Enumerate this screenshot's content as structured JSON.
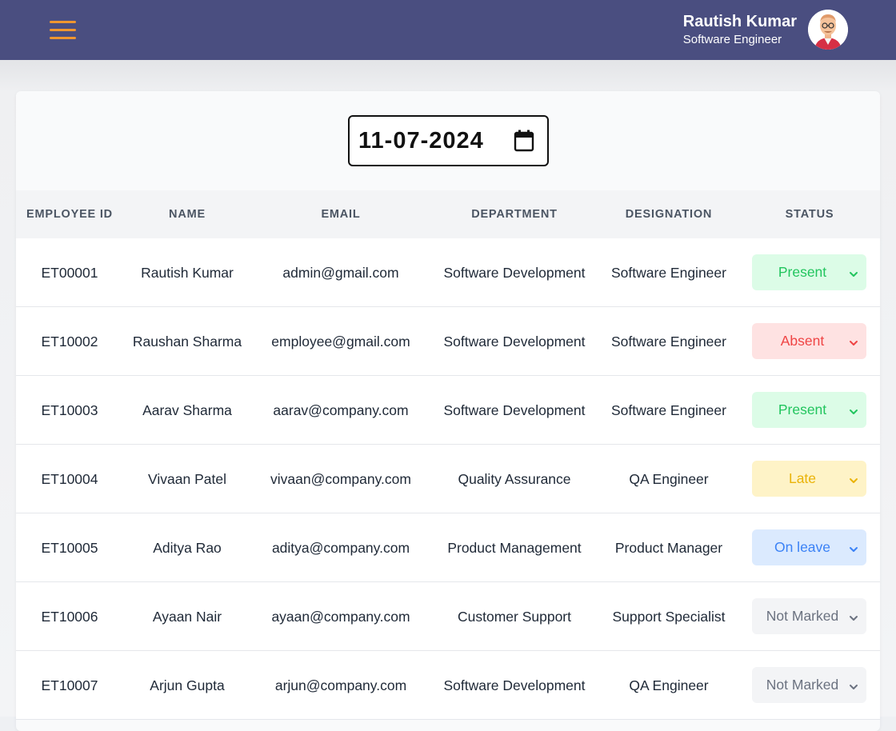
{
  "header": {
    "user_name": "Rautish Kumar",
    "user_role": "Software Engineer",
    "accent_color": "#f0962f",
    "bar_color": "#4a4e80"
  },
  "date_picker": {
    "value": "11-07-2024"
  },
  "table": {
    "columns": [
      "EMPLOYEE ID",
      "NAME",
      "EMAIL",
      "DEPARTMENT",
      "DESIGNATION",
      "STATUS"
    ],
    "rows": [
      {
        "id": "ET00001",
        "name": "Rautish Kumar",
        "email": "admin@gmail.com",
        "department": "Software Development",
        "designation": "Software Engineer",
        "status": "Present"
      },
      {
        "id": "ET10002",
        "name": "Raushan Sharma",
        "email": "employee@gmail.com",
        "department": "Software Development",
        "designation": "Software Engineer",
        "status": "Absent"
      },
      {
        "id": "ET10003",
        "name": "Aarav Sharma",
        "email": "aarav@company.com",
        "department": "Software Development",
        "designation": "Software Engineer",
        "status": "Present"
      },
      {
        "id": "ET10004",
        "name": "Vivaan Patel",
        "email": "vivaan@company.com",
        "department": "Quality Assurance",
        "designation": "QA Engineer",
        "status": "Late"
      },
      {
        "id": "ET10005",
        "name": "Aditya Rao",
        "email": "aditya@company.com",
        "department": "Product Management",
        "designation": "Product Manager",
        "status": "On leave"
      },
      {
        "id": "ET10006",
        "name": "Ayaan Nair",
        "email": "ayaan@company.com",
        "department": "Customer Support",
        "designation": "Support Specialist",
        "status": "Not Marked"
      },
      {
        "id": "ET10007",
        "name": "Arjun Gupta",
        "email": "arjun@company.com",
        "department": "Software Development",
        "designation": "QA Engineer",
        "status": "Not Marked"
      }
    ]
  },
  "status_colors": {
    "Present": {
      "bg": "#dcfce7",
      "fg": "#22c55e"
    },
    "Absent": {
      "bg": "#fee2e2",
      "fg": "#ef4444"
    },
    "Late": {
      "bg": "#fef3c7",
      "fg": "#eab308"
    },
    "On leave": {
      "bg": "#dbeafe",
      "fg": "#3b82f6"
    },
    "Not Marked": {
      "bg": "#f3f4f6",
      "fg": "#6b7280"
    }
  }
}
